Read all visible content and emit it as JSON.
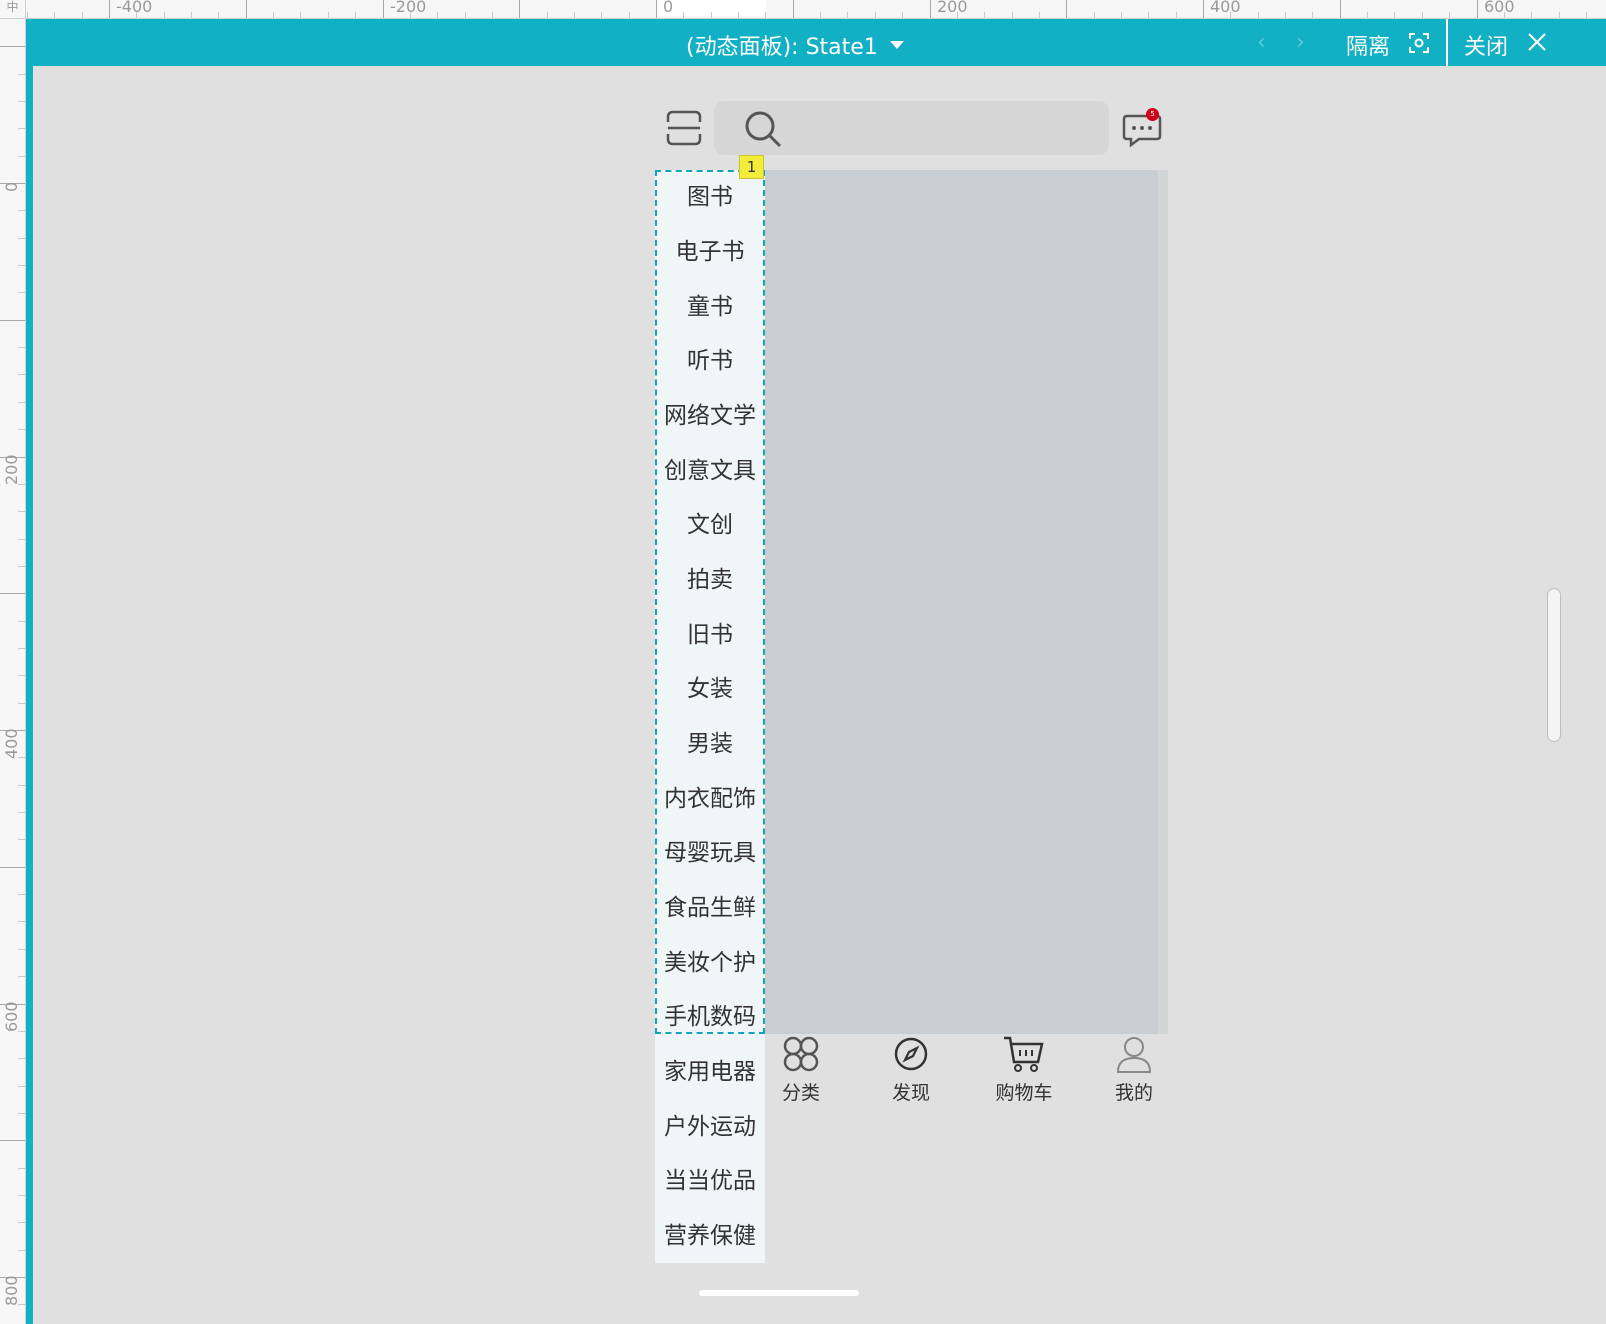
{
  "ruler": {
    "corner_symbol": "中",
    "top_labels": [
      "-400",
      "-200",
      "0",
      "200",
      "400",
      "600"
    ],
    "left_labels": [
      "0",
      "200",
      "400",
      "600",
      "800"
    ]
  },
  "title_bar": {
    "panel_title": "(动态面板):  State1",
    "isolate_label": "隔离",
    "close_label": "关闭"
  },
  "header": {
    "search_placeholder": "",
    "message_badge_count": "5"
  },
  "selection": {
    "index_label": "1"
  },
  "categories": [
    "图书",
    "电子书",
    "童书",
    "听书",
    "网络文学",
    "创意文具",
    "文创",
    "拍卖",
    "旧书",
    "女装",
    "男装",
    "内衣配饰",
    "母婴玩具",
    "食品生鲜",
    "美妆个护",
    "手机数码",
    "家用电器",
    "户外运动",
    "当当优品",
    "营养保健"
  ],
  "tabs": [
    {
      "label": "分类",
      "icon": "clover-icon"
    },
    {
      "label": "发现",
      "icon": "compass-icon"
    },
    {
      "label": "购物车",
      "icon": "cart-icon"
    },
    {
      "label": "我的",
      "icon": "user-icon"
    }
  ],
  "colors": {
    "accent": "#12b0c4",
    "canvas": "#e0e0e0",
    "content_area": "#c8ced1",
    "category_bg": "#f0f5f7",
    "badge": "#d0021b",
    "selection_index_bg": "#f3ed3a"
  }
}
